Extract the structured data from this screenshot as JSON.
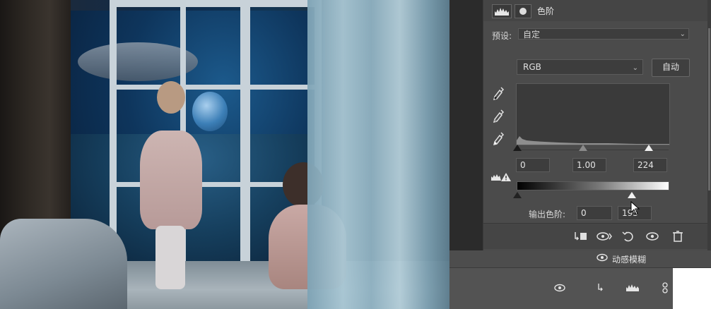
{
  "panel": {
    "title": "色阶",
    "preset_label": "预设:",
    "preset_value": "自定",
    "channel_value": "RGB",
    "auto_button": "自动",
    "input_black": "0",
    "input_gamma": "1.00",
    "input_white": "224",
    "output_label": "输出色阶:",
    "output_black": "0",
    "output_white": "195"
  },
  "icons": {
    "header_histogram": "levels-histogram-icon",
    "header_mask": "mask-icon",
    "eyedropper_black": "eyedropper-black-icon",
    "eyedropper_gray": "eyedropper-gray-icon",
    "eyedropper_white": "eyedropper-white-icon",
    "warning": "clipping-warning-icon",
    "footer": [
      "clip-to-layer-icon",
      "view-previous-icon",
      "reset-icon",
      "visibility-icon",
      "delete-icon"
    ]
  },
  "layers": {
    "layer1_name": "动感模糊"
  },
  "colors": {
    "panel_bg": "#4b4b4b",
    "field_bg": "#3d3d3d",
    "text": "#e0e0e0"
  }
}
